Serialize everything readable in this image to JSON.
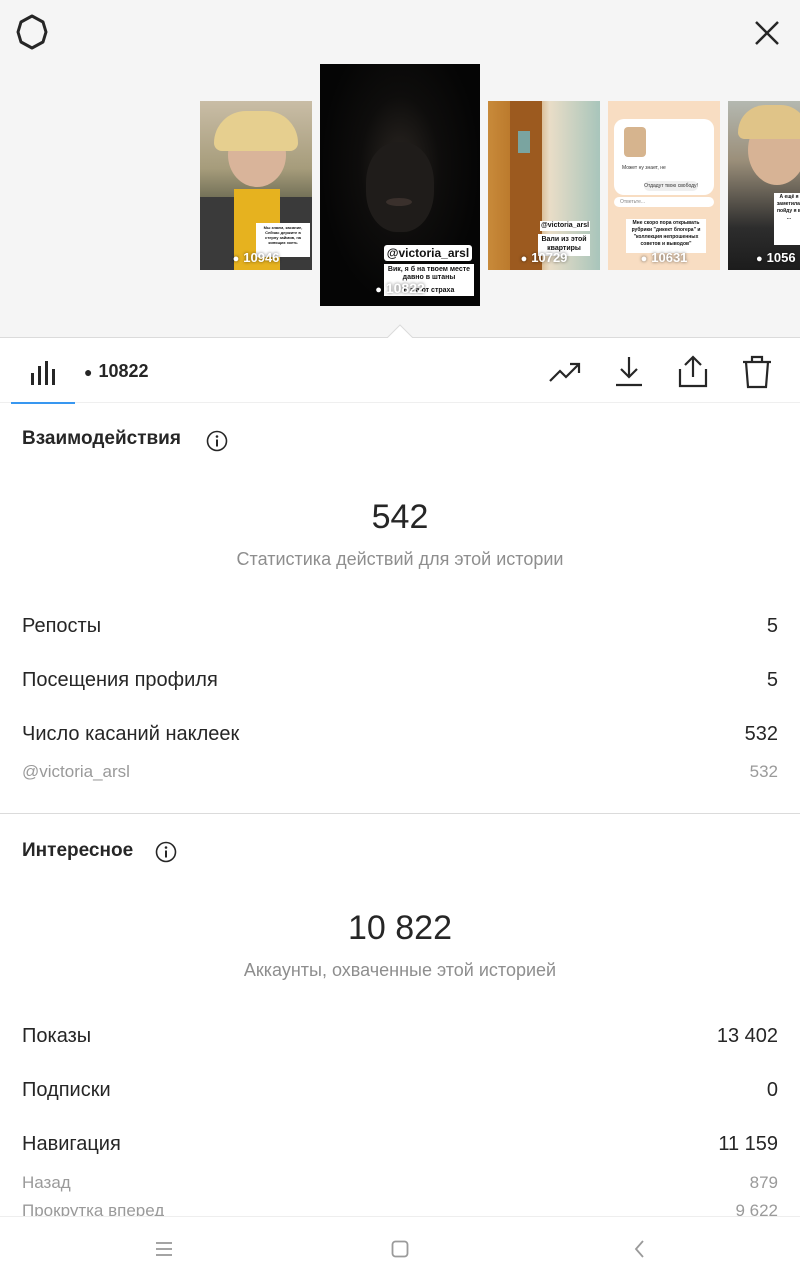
{
  "stories": [
    {
      "views": "10946",
      "caption": "Мы знаем, касание, Сейчас держите в стерну займив, на кипящих хкеть"
    },
    {
      "views": "10822",
      "handle": "@victoria_arsl",
      "caption": "Вик, я б на твоем месте давно в штаны",
      "caption2": "в а а  от страха"
    },
    {
      "views": "10729",
      "handle": "@victoria_arsl",
      "caption": "Вали из этой квартиры"
    },
    {
      "views": "10631",
      "caption": "Мне скоро пора открывать рубрики \"дикект блогера\" и \"коллекция непрошенных советов и выводов\"",
      "chat1": "Может ну знает, не",
      "chat2": "Отдадут твою свободу!",
      "reply": "Ответьте..."
    },
    {
      "views": "1056",
      "caption": "А ещё я заметила, пойду я в ..."
    }
  ],
  "tabs": {
    "views": "10822"
  },
  "interactions": {
    "title": "Взаимодействия",
    "total": "542",
    "subtitle": "Статистика действий для этой истории",
    "rows": [
      {
        "label": "Репосты",
        "value": "5"
      },
      {
        "label": "Посещения профиля",
        "value": "5"
      },
      {
        "label": "Число касаний наклеек",
        "value": "532"
      }
    ],
    "sticker_row": {
      "label": "@victoria_arsl",
      "value": "532"
    }
  },
  "discovery": {
    "title": "Интересное",
    "total": "10 822",
    "subtitle": "Аккаунты, охваченные этой историей",
    "rows": [
      {
        "label": "Показы",
        "value": "13 402"
      },
      {
        "label": "Подписки",
        "value": "0"
      },
      {
        "label": "Навигация",
        "value": "11 159"
      }
    ],
    "minor_rows": [
      {
        "label": "Назад",
        "value": "879"
      },
      {
        "label": "Прокрутка вперед",
        "value": "9 622"
      }
    ]
  },
  "colors": {
    "accent": "#3897f0",
    "text": "#262626",
    "muted": "#8e8e8e"
  },
  "icons": [
    "settings-gear-icon",
    "close-icon",
    "bar-chart-icon",
    "eye-icon",
    "trending-icon",
    "download-icon",
    "share-icon",
    "trash-icon",
    "info-icon",
    "menu-icon",
    "home-square-icon",
    "back-icon"
  ]
}
